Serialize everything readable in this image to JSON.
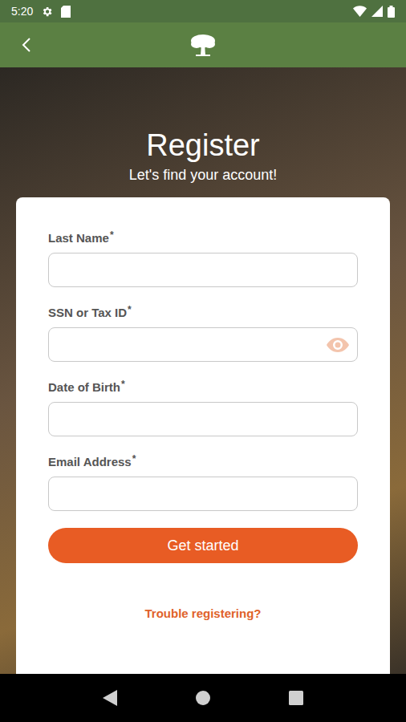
{
  "status_bar": {
    "time": "5:20"
  },
  "header": {
    "title": "Register",
    "subtitle": "Let's find your account!"
  },
  "form": {
    "fields": [
      {
        "label": "Last Name",
        "required_mark": "*",
        "kind": "text"
      },
      {
        "label": "SSN or Tax ID",
        "required_mark": "*",
        "kind": "secret"
      },
      {
        "label": "Date of Birth",
        "required_mark": "*",
        "kind": "text"
      },
      {
        "label": "Email Address",
        "required_mark": "*",
        "kind": "text"
      }
    ],
    "submit": "Get started",
    "help_link": "Trouble registering?"
  }
}
